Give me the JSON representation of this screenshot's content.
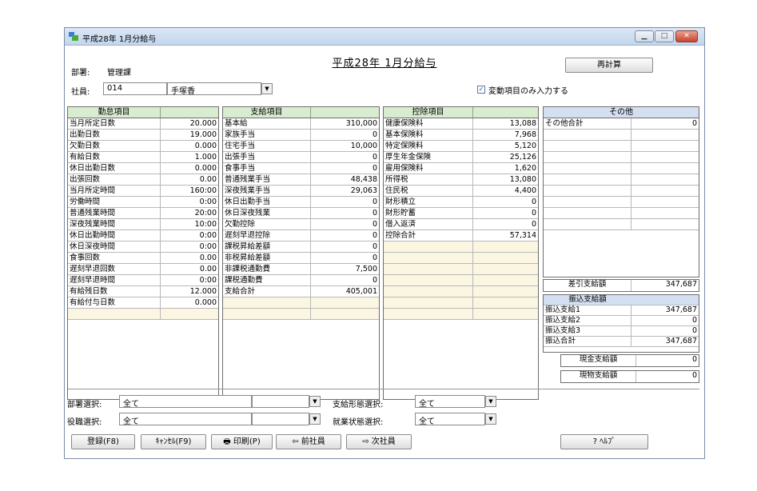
{
  "window": {
    "title": "平成28年 1月分給与"
  },
  "header": {
    "dept_label": "部署:",
    "dept_value": "管理課",
    "employee_label": "社員:",
    "employee_code": "014",
    "employee_name": "手塚香",
    "page_title": "平成28年 1月分給与",
    "recalc_label": "再計算",
    "checkbox_label": "変動項目のみ入力する",
    "checkbox_checked": true
  },
  "attendance": {
    "header": "勤怠項目",
    "rows": [
      {
        "name": "当月所定日数",
        "value": "20.000"
      },
      {
        "name": "出勤日数",
        "value": "19.000"
      },
      {
        "name": "欠勤日数",
        "value": "0.000"
      },
      {
        "name": "有給日数",
        "value": "1.000"
      },
      {
        "name": "休日出勤日数",
        "value": "0.000"
      },
      {
        "name": "出張回数",
        "value": "0.00"
      },
      {
        "name": "当月所定時間",
        "value": "160:00"
      },
      {
        "name": "労働時間",
        "value": "0:00"
      },
      {
        "name": "普通残業時間",
        "value": "20:00"
      },
      {
        "name": "深夜残業時間",
        "value": "10:00"
      },
      {
        "name": "休日出勤時間",
        "value": "0:00"
      },
      {
        "name": "休日深夜時間",
        "value": "0:00"
      },
      {
        "name": "食事回数",
        "value": "0.00"
      },
      {
        "name": "遅刻早退回数",
        "value": "0.00"
      },
      {
        "name": "遅刻早退時間",
        "value": "0:00"
      },
      {
        "name": "有給残日数",
        "value": "12.000"
      },
      {
        "name": "有給付与日数",
        "value": "0.000"
      },
      {
        "name": "",
        "value": ""
      }
    ]
  },
  "payments": {
    "header": "支給項目",
    "rows": [
      {
        "name": "基本給",
        "value": "310,000"
      },
      {
        "name": "家族手当",
        "value": "0"
      },
      {
        "name": "住宅手当",
        "value": "10,000"
      },
      {
        "name": "出張手当",
        "value": "0"
      },
      {
        "name": "食事手当",
        "value": "0"
      },
      {
        "name": "普通残業手当",
        "value": "48,438"
      },
      {
        "name": "深夜残業手当",
        "value": "29,063"
      },
      {
        "name": "休日出勤手当",
        "value": "0"
      },
      {
        "name": "休日深夜残業",
        "value": "0"
      },
      {
        "name": "欠勤控除",
        "value": "0"
      },
      {
        "name": "遅刻早退控除",
        "value": "0"
      },
      {
        "name": "課税昇給差額",
        "value": "0"
      },
      {
        "name": "非税昇給差額",
        "value": "0"
      },
      {
        "name": "非課税通勤費",
        "value": "7,500"
      },
      {
        "name": "課税通勤費",
        "value": "0"
      },
      {
        "name": "支給合計",
        "value": "405,001"
      },
      {
        "name": "",
        "value": ""
      },
      {
        "name": "",
        "value": ""
      }
    ]
  },
  "deductions": {
    "header": "控除項目",
    "rows": [
      {
        "name": "健康保険料",
        "value": "13,088"
      },
      {
        "name": " 基本保険料",
        "value": "7,968"
      },
      {
        "name": " 特定保険料",
        "value": "5,120"
      },
      {
        "name": "厚生年金保険",
        "value": "25,126"
      },
      {
        "name": "雇用保険料",
        "value": "1,620"
      },
      {
        "name": "所得税",
        "value": "13,080"
      },
      {
        "name": "住民税",
        "value": "4,400"
      },
      {
        "name": "財形積立",
        "value": "0"
      },
      {
        "name": "財形貯蓄",
        "value": "0"
      },
      {
        "name": "借入返済",
        "value": "0"
      },
      {
        "name": "控除合計",
        "value": "57,314"
      },
      {
        "name": "",
        "value": ""
      },
      {
        "name": "",
        "value": ""
      },
      {
        "name": "",
        "value": ""
      },
      {
        "name": "",
        "value": ""
      },
      {
        "name": "",
        "value": ""
      },
      {
        "name": "",
        "value": ""
      },
      {
        "name": "",
        "value": ""
      }
    ]
  },
  "other": {
    "header": "その他",
    "rows": [
      {
        "name": "その他合計",
        "value": "0"
      },
      {
        "name": "",
        "value": ""
      },
      {
        "name": "",
        "value": ""
      },
      {
        "name": "",
        "value": ""
      },
      {
        "name": "",
        "value": ""
      },
      {
        "name": "",
        "value": ""
      },
      {
        "name": "",
        "value": ""
      },
      {
        "name": "",
        "value": ""
      },
      {
        "name": "",
        "value": ""
      },
      {
        "name": "",
        "value": ""
      }
    ],
    "net_label": "差引支給額",
    "net_value": "347,687",
    "transfer_header": "振込支給額",
    "transfers": [
      {
        "name": "振込支給1",
        "value": "347,687"
      },
      {
        "name": "振込支給2",
        "value": "0"
      },
      {
        "name": "振込支給3",
        "value": "0"
      },
      {
        "name": "振込合計",
        "value": "347,687"
      }
    ],
    "cash_label": "現金支給額",
    "cash_value": "0",
    "goods_label": "現物支給額",
    "goods_value": "0"
  },
  "filters": {
    "dept_select_label": "部署選択:",
    "dept_select_value": "全て",
    "role_select_label": "役職選択:",
    "role_select_value": "全て",
    "payform_label": "支給形態選択:",
    "payform_value": "全て",
    "workstatus_label": "就業状態選択:",
    "workstatus_value": "全て"
  },
  "buttons": {
    "register": "登録(F8)",
    "cancel": "ｷｬﾝｾﾙ(F9)",
    "print": "印刷(P)",
    "prev": "前社員",
    "next": "次社員",
    "help": "ﾍﾙﾌﾟ"
  }
}
